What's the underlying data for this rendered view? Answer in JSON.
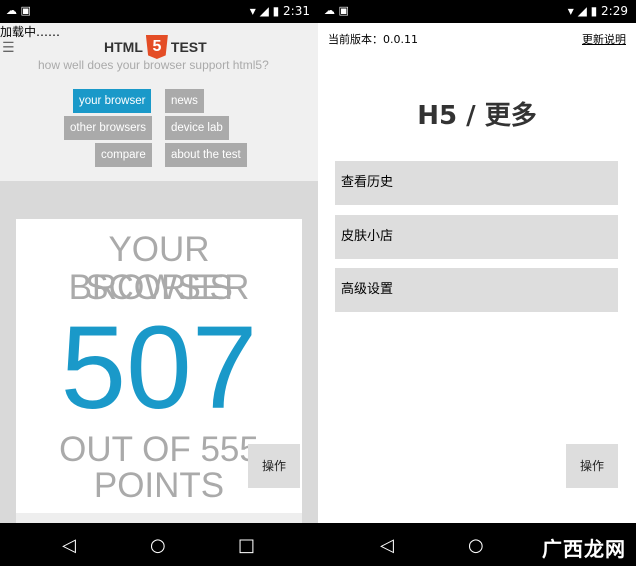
{
  "left": {
    "status_time": "2:31",
    "loading": "加载中……",
    "logo_left": "HTML",
    "logo_num": "5",
    "logo_right": "TEST",
    "tagline": "how well does your browser support html5?",
    "nav": [
      "your browser",
      "news",
      "other browsers",
      "device lab",
      "compare",
      "about the test"
    ],
    "score_line1": "YOUR BROWSER",
    "score_line2": "SCORES",
    "score": "507",
    "out_of": "OUT OF 555",
    "points": "POINTS",
    "action_button": "操作"
  },
  "right": {
    "status_time": "2:29",
    "version": "当前版本：0.0.11",
    "update_notes": "更新说明",
    "title": "H5 / 更多",
    "items": [
      "查看历史",
      "皮肤小店",
      "高级设置"
    ],
    "action_button": "操作",
    "watermark": "广西龙网"
  }
}
